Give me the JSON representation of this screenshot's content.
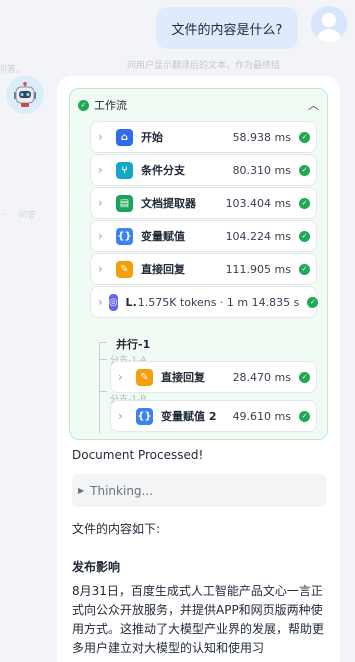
{
  "background_text": {
    "left_top": "问答。",
    "left_mid_a": "…",
    "left_mid_b": "问答"
  },
  "user_message": {
    "text": "文件的内容是什么?",
    "hint": "问用户显示翻译后的文本，作为最终结"
  },
  "workflow": {
    "title": "工作流",
    "toggle_icon": "chevron-up-icon",
    "steps": [
      {
        "label": "开始",
        "time": "58.938 ms",
        "icon": "home-icon",
        "color": "#2f6bf0"
      },
      {
        "label": "条件分支",
        "time": "80.310 ms",
        "icon": "branch-icon",
        "color": "#13a6c9"
      },
      {
        "label": "文档提取器",
        "time": "103.404 ms",
        "icon": "document-icon",
        "color": "#1aa35a"
      },
      {
        "label": "变量赋值",
        "time": "104.224 ms",
        "icon": "variable-icon",
        "color": "#3b82f6"
      },
      {
        "label": "直接回复",
        "time": "111.905 ms",
        "icon": "reply-icon",
        "color": "#f59e0b"
      },
      {
        "label": "L",
        "tokens": "1.575K tokens · 1 m 14.835 s",
        "icon": "llm-icon",
        "color": "#6366f1"
      }
    ],
    "parallel": {
      "label": "并行-1",
      "branches": [
        {
          "tag": "分支-1-A",
          "label": "直接回复",
          "time": "28.470 ms",
          "icon": "reply-icon",
          "color": "#f59e0b"
        },
        {
          "tag": "分支-1-B",
          "label": "变量赋值 2",
          "time": "49.610 ms",
          "icon": "variable-icon",
          "color": "#3b82f6"
        }
      ]
    }
  },
  "answer": {
    "processed": "Document Processed!",
    "thinking": "Thinking...",
    "intro": "文件的内容如下:",
    "section_title": "发布影响",
    "paragraph": "8月31日，百度生成式人工智能产品文心一言正式向公众开放服务，并提供APP和网页版两种使用方式。这推动了大模型产业界的发展，帮助更多用户建立对大模型的认知和使用习"
  },
  "colors": {
    "success": "#1fa856",
    "user_bubble": "#dfeafc",
    "workflow_bg": "#f0fbf4"
  }
}
